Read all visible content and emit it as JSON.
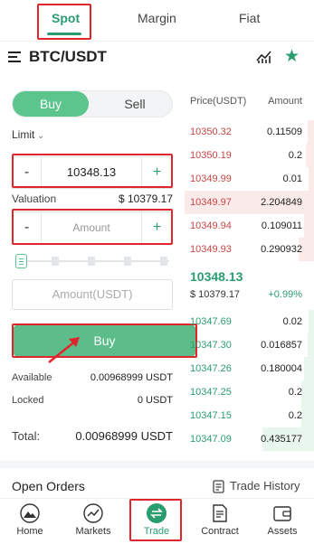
{
  "top_tabs": [
    {
      "label": "Spot",
      "active": true
    },
    {
      "label": "Margin",
      "active": false
    },
    {
      "label": "Fiat",
      "active": false
    }
  ],
  "header": {
    "pair": "BTC/USDT",
    "chart_icon": "line-chart-icon",
    "favorite_icon": "star-icon"
  },
  "order_form": {
    "buy_label": "Buy",
    "sell_label": "Sell",
    "order_type": "Limit",
    "price_value": "10348.13",
    "valuation_label": "Valuation",
    "valuation_value": "$ 10379.17",
    "amount_placeholder": "Amount",
    "minus": "-",
    "plus": "+",
    "amount_usdt_placeholder": "Amount(USDT)",
    "submit_label": "Buy",
    "available_label": "Available",
    "available_value": "0.00968999 USDT",
    "locked_label": "Locked",
    "locked_value": "0 USDT",
    "total_label": "Total:",
    "total_value": "0.00968999 USDT"
  },
  "order_book": {
    "price_header": "Price(USDT)",
    "amount_header": "Amount",
    "asks": [
      {
        "price": "10350.32",
        "amount": "0.11509",
        "depth": 0.05
      },
      {
        "price": "10350.19",
        "amount": "0.2",
        "depth": 0.06
      },
      {
        "price": "10349.99",
        "amount": "0.01",
        "depth": 0.04
      },
      {
        "price": "10349.97",
        "amount": "2.204849",
        "depth": 1.0
      },
      {
        "price": "10349.94",
        "amount": "0.109011",
        "depth": 0.08
      },
      {
        "price": "10349.93",
        "amount": "0.290932",
        "depth": 0.12
      }
    ],
    "last_price": "10348.13",
    "last_valuation": "$ 10379.17",
    "change": "+0.99%",
    "bids": [
      {
        "price": "10347.69",
        "amount": "0.02",
        "depth": 0.04
      },
      {
        "price": "10347.30",
        "amount": "0.016857",
        "depth": 0.05
      },
      {
        "price": "10347.26",
        "amount": "0.180004",
        "depth": 0.08
      },
      {
        "price": "10347.25",
        "amount": "0.2",
        "depth": 0.1
      },
      {
        "price": "10347.15",
        "amount": "0.2",
        "depth": 0.1
      },
      {
        "price": "10347.09",
        "amount": "0.435177",
        "depth": 0.4
      }
    ]
  },
  "open_orders": {
    "title": "Open Orders",
    "history_label": "Trade History"
  },
  "bottom_nav": [
    {
      "label": "Home",
      "icon": "mountain-icon",
      "active": false
    },
    {
      "label": "Markets",
      "icon": "trend-icon",
      "active": false
    },
    {
      "label": "Trade",
      "icon": "swap-icon",
      "active": true
    },
    {
      "label": "Contract",
      "icon": "document-icon",
      "active": false
    },
    {
      "label": "Assets",
      "icon": "wallet-icon",
      "active": false
    }
  ],
  "colors": {
    "accent": "#2a9d6e",
    "buy_button": "#5cbd8a",
    "ask": "#c74545",
    "highlight_box": "#e0262c"
  }
}
